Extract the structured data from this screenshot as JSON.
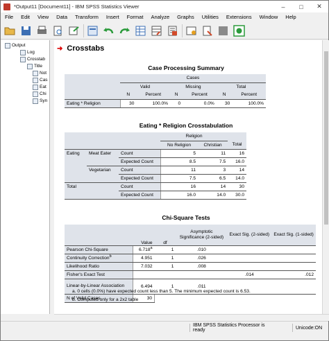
{
  "window": {
    "title": "*Output11 [Document11] - IBM SPSS Statistics Viewer"
  },
  "menu": [
    "File",
    "Edit",
    "View",
    "Data",
    "Transform",
    "Insert",
    "Format",
    "Analyze",
    "Graphs",
    "Utilities",
    "Extensions",
    "Window",
    "Help"
  ],
  "outline": {
    "items": [
      "Output",
      "Log",
      "Crosstab",
      "Title",
      "Not",
      "Cas",
      "Eat",
      "Chi",
      "Syn"
    ]
  },
  "heading": "Crosstabs",
  "case_summary": {
    "title": "Case Processing Summary",
    "group": "Cases",
    "sub": [
      "Valid",
      "Missing",
      "Total"
    ],
    "cols": [
      "N",
      "Percent",
      "N",
      "Percent",
      "N",
      "Percent"
    ],
    "row_label": "Eating * Religion",
    "values": [
      "30",
      "100.0%",
      "0",
      "0.0%",
      "30",
      "100.0%"
    ]
  },
  "crosstab": {
    "title": "Eating * Religion Crosstabulation",
    "col_group": "Religion",
    "cols": [
      "No Religion",
      "Christian",
      "Total"
    ],
    "row_var": "Eating",
    "rows": [
      {
        "group": "Meat Eater",
        "stat": "Count",
        "values": [
          "5",
          "11",
          "16"
        ]
      },
      {
        "group": "",
        "stat": "Expected Count",
        "values": [
          "8.5",
          "7.5",
          "16.0"
        ]
      },
      {
        "group": "Vegetarian",
        "stat": "Count",
        "values": [
          "11",
          "3",
          "14"
        ]
      },
      {
        "group": "",
        "stat": "Expected Count",
        "values": [
          "7.5",
          "6.5",
          "14.0"
        ]
      },
      {
        "group": "Total",
        "stat": "Count",
        "values": [
          "16",
          "14",
          "30"
        ]
      },
      {
        "group": "",
        "stat": "Expected Count",
        "values": [
          "16.0",
          "14.0",
          "30.0"
        ]
      }
    ]
  },
  "chi": {
    "title": "Chi-Square Tests",
    "cols": [
      "Value",
      "df",
      "Asymptotic Significance (2-sided)",
      "Exact Sig. (2-sided)",
      "Exact Sig. (1-sided)"
    ],
    "rows": [
      {
        "label": "Pearson Chi-Square",
        "value": "6.718",
        "sup": "a",
        "df": "1",
        "asym": ".010",
        "e2": "",
        "e1": ""
      },
      {
        "label": "Continuity Correction",
        "value": "4.951",
        "sup": "b",
        "df": "1",
        "asym": ".026",
        "e2": "",
        "e1": ""
      },
      {
        "label": "Likelihood Ratio",
        "value": "7.032",
        "sup": "",
        "df": "1",
        "asym": ".008",
        "e2": "",
        "e1": ""
      },
      {
        "label": "Fisher's Exact Test",
        "value": "",
        "sup": "",
        "df": "",
        "asym": "",
        "e2": ".014",
        "e1": ".012"
      },
      {
        "label": "Linear-by-Linear Association",
        "value": "6.494",
        "sup": "",
        "df": "1",
        "asym": ".011",
        "e2": "",
        "e1": ""
      },
      {
        "label": "N of Valid Cases",
        "value": "30",
        "sup": "",
        "df": "",
        "asym": "",
        "e2": "",
        "e1": ""
      }
    ],
    "footnotes": [
      "a. 0 cells (0.0%) have expected count less than 5. The minimum expected count is 6.53.",
      "b. Computed only for a 2x2 table"
    ]
  },
  "status": {
    "processor": "IBM SPSS Statistics Processor is ready",
    "unicode": "Unicode:ON"
  },
  "colors": {
    "shaded": "#dfe3ea",
    "accent": "#d00000"
  }
}
